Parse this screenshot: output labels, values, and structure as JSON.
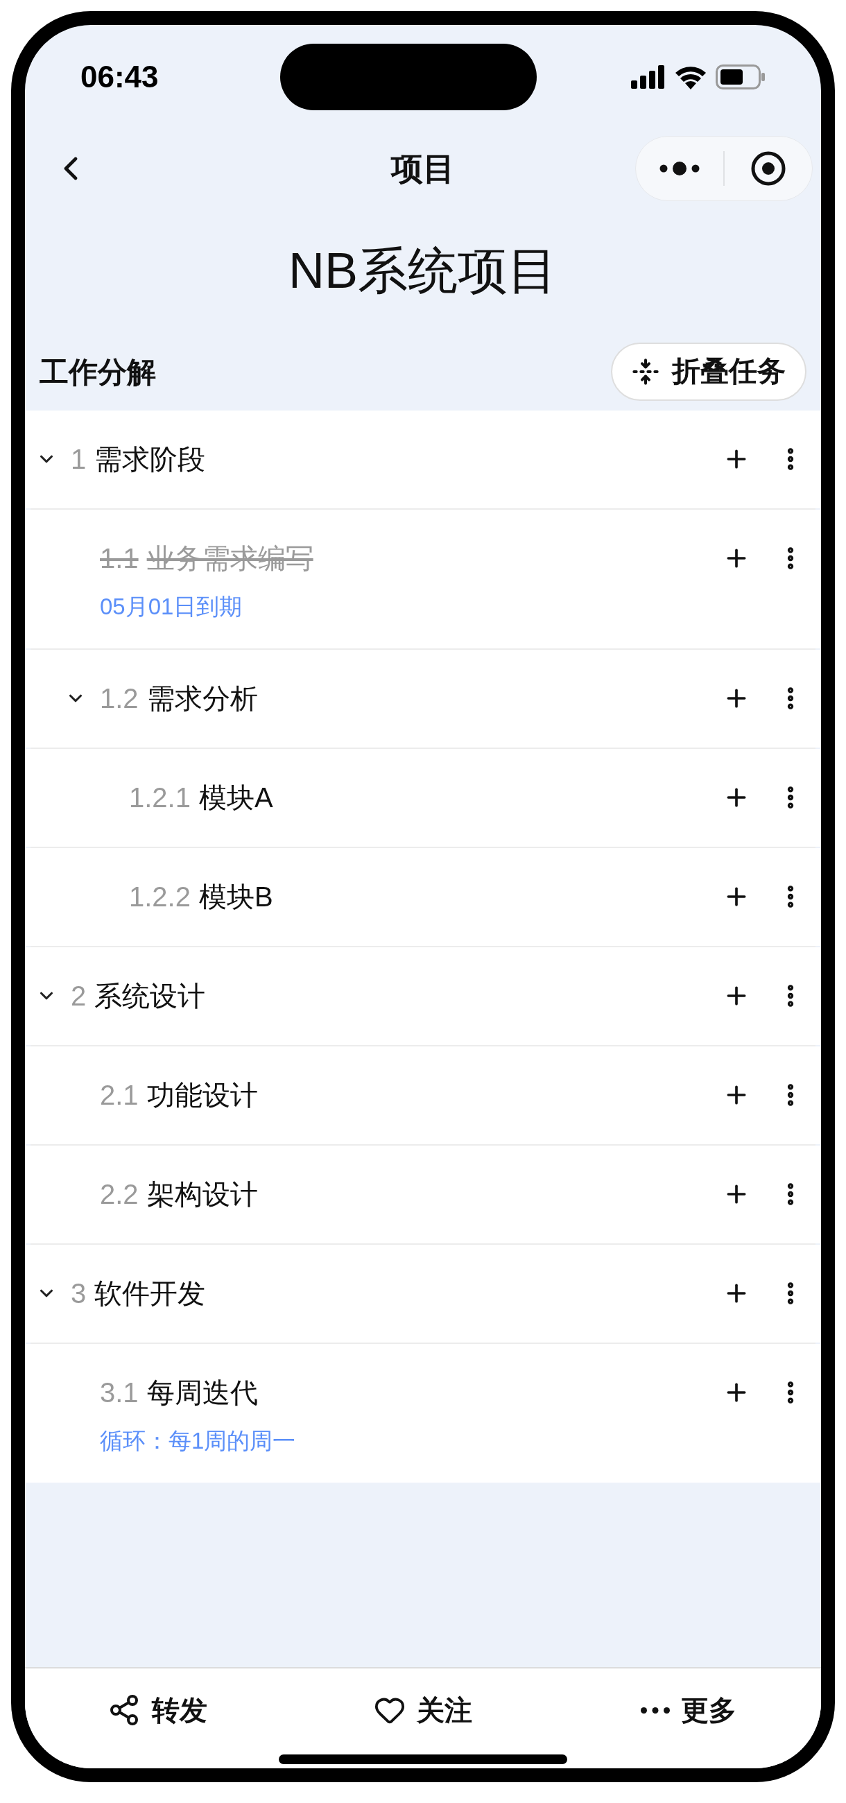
{
  "status_bar": {
    "time": "06:43"
  },
  "nav": {
    "title": "项目"
  },
  "project_title": "NB系统项目",
  "section": {
    "title": "工作分解",
    "collapse_button": "折叠任务"
  },
  "tasks": [
    {
      "number": "1",
      "title": "需求阶段",
      "done": false,
      "expanded": true,
      "children": [
        {
          "number": "1.1",
          "title": "业务需求编写",
          "done": true,
          "note": "05月01日到期"
        },
        {
          "number": "1.2",
          "title": "需求分析",
          "done": false,
          "expanded": true,
          "children": [
            {
              "number": "1.2.1",
              "title": "模块A",
              "done": false
            },
            {
              "number": "1.2.2",
              "title": "模块B",
              "done": false
            }
          ]
        }
      ]
    },
    {
      "number": "2",
      "title": "系统设计",
      "done": false,
      "expanded": true,
      "children": [
        {
          "number": "2.1",
          "title": "功能设计",
          "done": false
        },
        {
          "number": "2.2",
          "title": "架构设计",
          "done": false
        }
      ]
    },
    {
      "number": "3",
      "title": "软件开发",
      "done": false,
      "expanded": true,
      "children": [
        {
          "number": "3.1",
          "title": "每周迭代",
          "done": false,
          "note": "循环：每1周的周一"
        }
      ]
    }
  ],
  "bottom_bar": [
    {
      "kind": "share",
      "label": "转发"
    },
    {
      "kind": "follow",
      "label": "关注"
    },
    {
      "kind": "more",
      "label": "更多"
    }
  ]
}
